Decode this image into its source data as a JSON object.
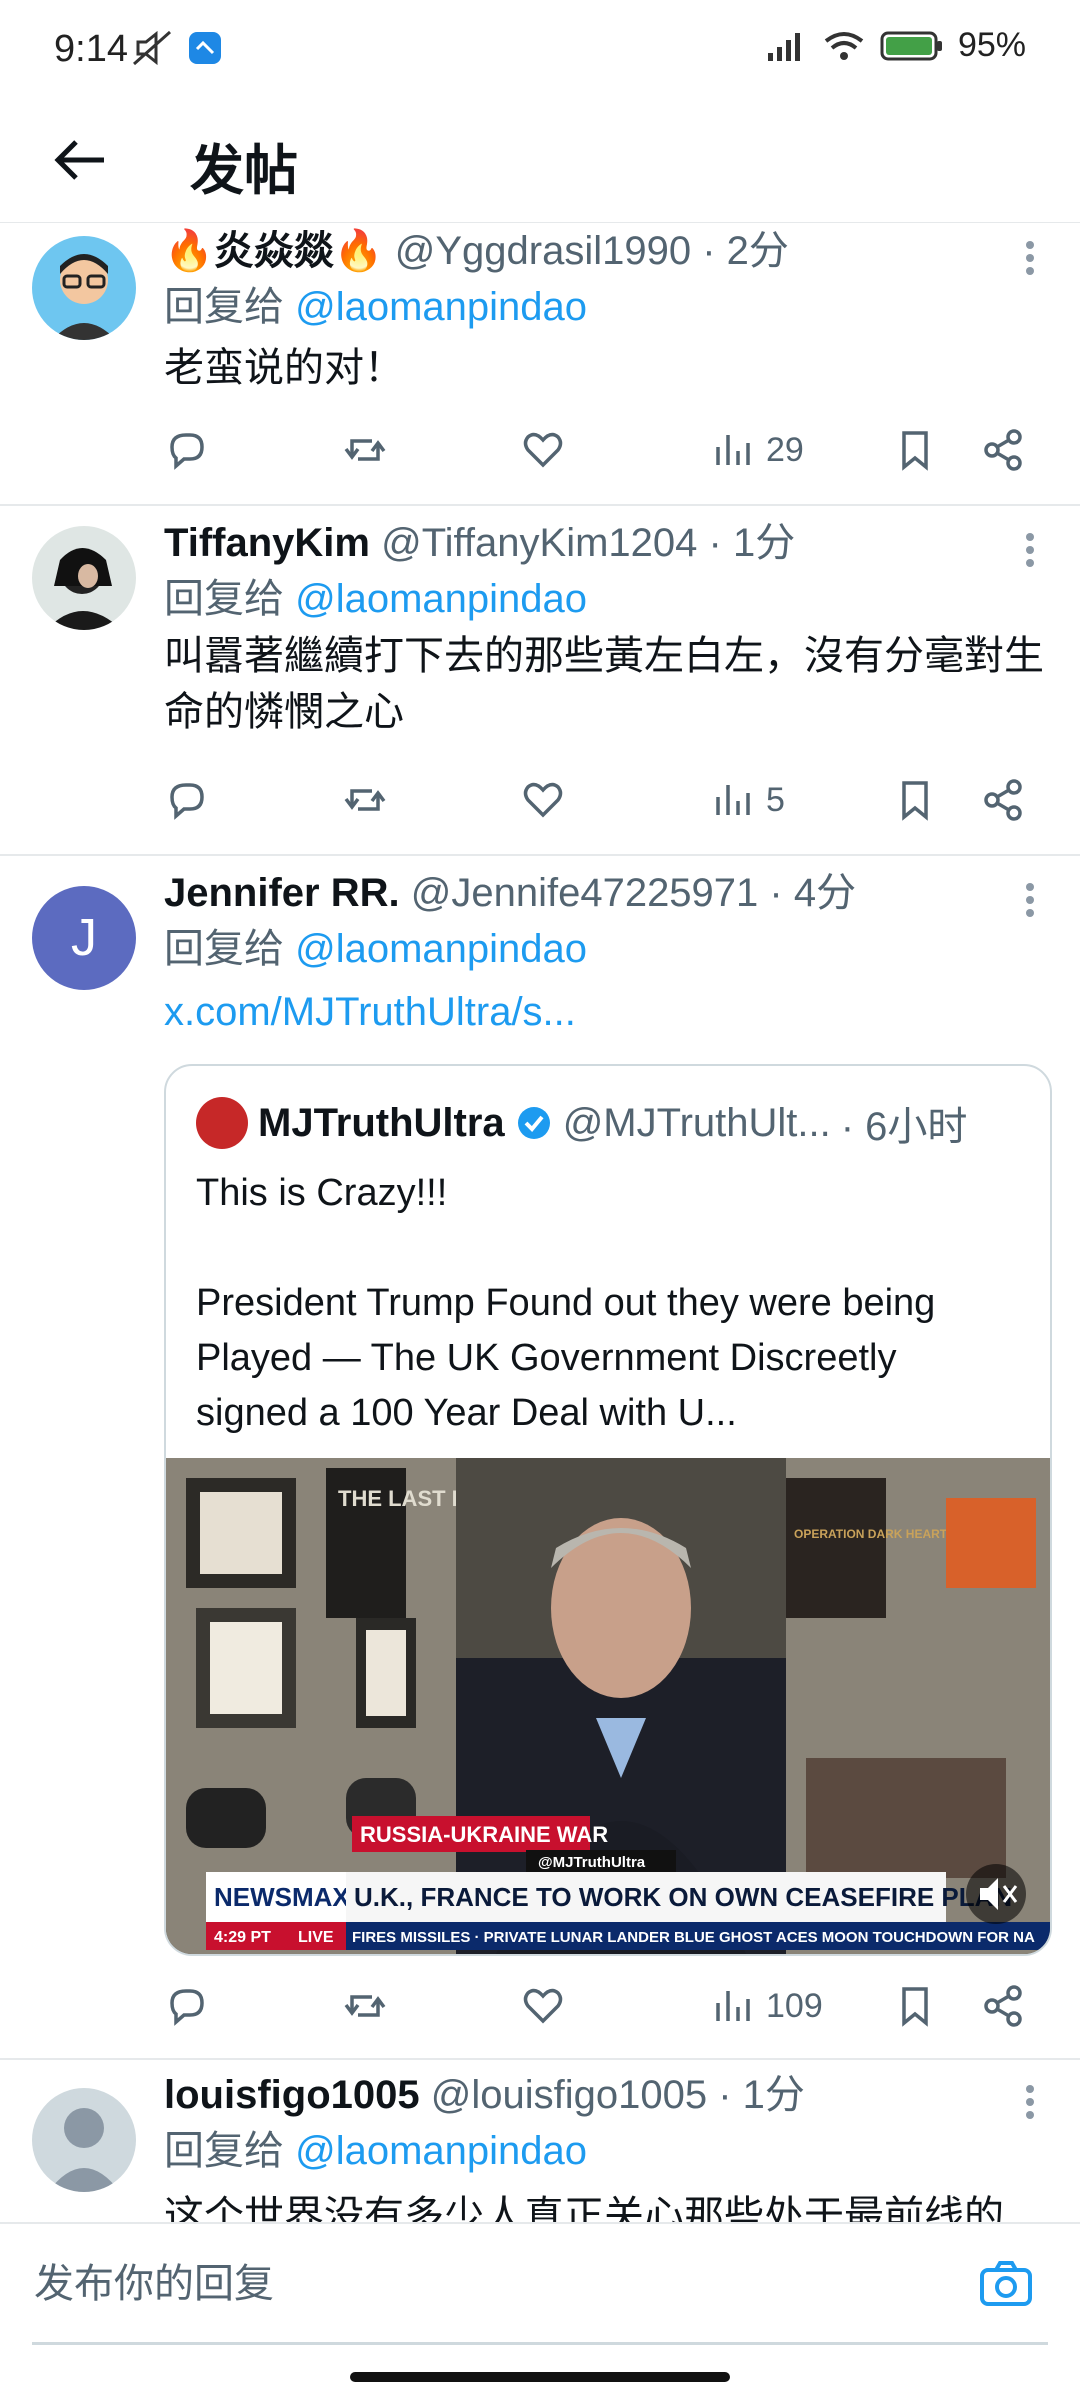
{
  "status": {
    "time": "9:14",
    "battery": "95%"
  },
  "header": {
    "title": "发帖"
  },
  "tweets": [
    {
      "name": "🔥炎焱燚🔥",
      "handle": "@Yggdrasil1990",
      "time": "· 2分",
      "reply_prefix": "回复给",
      "reply_to": "@laomanpindao",
      "text": "老蛮说的对！",
      "views": "29"
    },
    {
      "name": "TiffanyKim",
      "handle": "@TiffanyKim1204",
      "time": "· 1分",
      "reply_prefix": "回复给",
      "reply_to": "@laomanpindao",
      "text": "叫囂著繼續打下去的那些黃左白左，沒有分毫對生命的憐憫之心",
      "views": "5"
    },
    {
      "name": "Jennifer RR.",
      "handle": "@Jennife47225971",
      "time": "· 4分",
      "avatar_letter": "J",
      "reply_prefix": "回复给",
      "reply_to": "@laomanpindao",
      "link": "x.com/MJTruthUltra/s...",
      "views": "109",
      "quote": {
        "name": "MJTruthUltra",
        "handle": "@MJTruthUlt...",
        "time": "· 6小时",
        "line1": "This is Crazy!!!",
        "line2": "President Trump Found out they were being Played — The UK Government Discreetly signed a 100 Year Deal with U...",
        "video": {
          "banner_top": "RUSSIA-UKRAINE WAR",
          "network": "NEWSMAX",
          "headline": "U.K., FRANCE TO WORK ON OWN CEASEFIRE PLAN",
          "watermark": "@MJTruthUltra",
          "clock": "4:29 PT",
          "live": "LIVE",
          "ticker": "FIRES MISSILES · PRIVATE LUNAR LANDER BLUE GHOST ACES MOON TOUCHDOWN FOR NA",
          "book_title": "THE LAST LINE",
          "shelf_sign": "OPERATION DARK HEART"
        }
      }
    },
    {
      "name": "louisfigo1005",
      "handle": "@louisfigo1005",
      "time": "· 1分",
      "reply_prefix": "回复给",
      "reply_to": "@laomanpindao",
      "text": "这个世界没有多少人真正关心那些处于最前线的"
    }
  ],
  "composer": {
    "placeholder": "发布你的回复"
  },
  "icons": [
    "back-arrow-icon",
    "reply-icon",
    "retweet-icon",
    "like-icon",
    "views-icon",
    "bookmark-icon",
    "share-icon",
    "more-icon",
    "camera-icon",
    "verified-icon"
  ],
  "colors": {
    "accent": "#1d9bf0",
    "muted": "#536471",
    "divider": "#e6e9eb"
  }
}
